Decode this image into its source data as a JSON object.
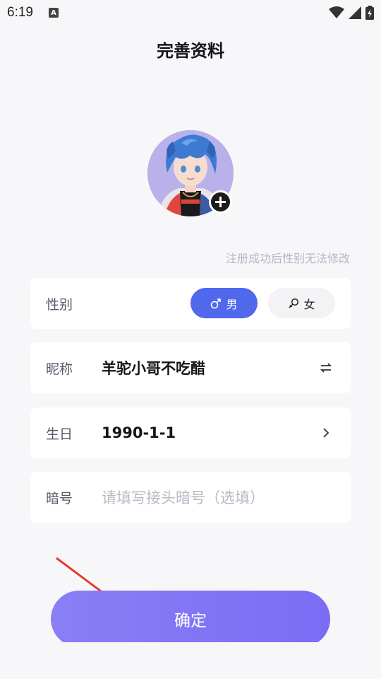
{
  "status": {
    "time": "6:19",
    "notif_glyph": "A"
  },
  "page": {
    "title": "完善资料"
  },
  "avatar": {
    "add_icon": "plus-circle-icon"
  },
  "hint": "注册成功后性别无法修改",
  "gender": {
    "label": "性别",
    "male": "男",
    "female": "女",
    "selected": "男",
    "male_color": "#4f68ec"
  },
  "nickname": {
    "label": "昵称",
    "value": "羊驼小哥不吃醋",
    "action_icon": "swap-icon"
  },
  "birthday": {
    "label": "生日",
    "value": "1990-1-1",
    "action_icon": "chevron-right-icon"
  },
  "code": {
    "label": "暗号",
    "placeholder": "请填写接头暗号（选填）"
  },
  "confirm": {
    "label": "确定",
    "color": "#7b6cf4"
  }
}
